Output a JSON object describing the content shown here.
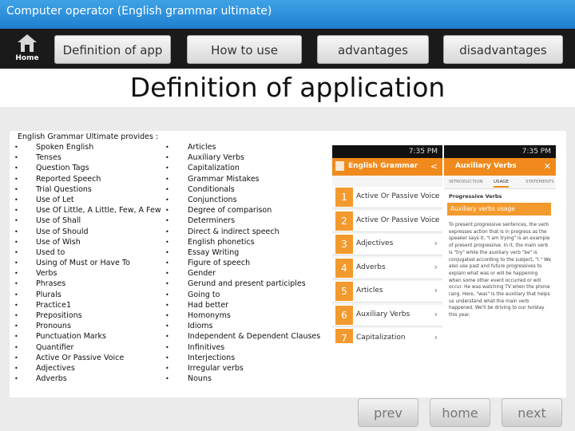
{
  "window": {
    "title": "Computer operator (English grammar ultimate)"
  },
  "nav": {
    "home_label": "Home",
    "tabs": [
      "Definition of app",
      "How to use",
      "advantages",
      "disadvantages"
    ]
  },
  "heading": "Definition of application",
  "list_intro": "English Grammar Ultimate provides :",
  "bullet": "•",
  "column1": [
    "Spoken English",
    "Tenses",
    "Question Tags",
    "Reported Speech",
    "Trial Questions",
    "Use of Let",
    "Use Of Little, A Little, Few, A Few",
    "Use of Shall",
    "Use of Should",
    "Use of Wish",
    "Used to",
    "Using of Must or Have To",
    "Verbs",
    "Phrases",
    "Plurals",
    "Practice1",
    "Prepositions",
    "Pronouns",
    "Punctuation Marks",
    "Quantifier",
    "Active Or Passive Voice",
    "Adjectives",
    "Adverbs"
  ],
  "column2": [
    "Articles",
    "Auxiliary Verbs",
    "Capitalization",
    "Grammar Mistakes",
    "Conditionals",
    "Conjunctions",
    "Degree of comparison",
    "Determiners",
    "Direct & indirect speech",
    "English phonetics",
    "Essay Writing",
    "Figure of speech",
    "Gender",
    "Gerund and present participles",
    "Going to",
    "Had better",
    "Homonyms",
    "Idioms",
    "Independent & Dependent Clauses",
    "Infinitives",
    "Interjections",
    "Irregular verbs",
    "Nouns"
  ],
  "phone": {
    "time_left": "7:35 PM",
    "time_right": "7:35 PM",
    "left_title": "English Grammar",
    "right_title": "Auxiliary Verbs",
    "items": [
      {
        "num": "1",
        "label": "Active Or Passive Voice"
      },
      {
        "num": "2",
        "label": "Active Or Passive Voice"
      },
      {
        "num": "3",
        "label": "Adjectives"
      },
      {
        "num": "4",
        "label": "Adverbs"
      },
      {
        "num": "5",
        "label": "Articles"
      },
      {
        "num": "6",
        "label": "Auxiliary Verbs"
      },
      {
        "num": "7",
        "label": "Capitalization"
      }
    ],
    "tabs": [
      "INTRODUCTION",
      "USAGE",
      "STATEMENTS"
    ],
    "section": "Progressive Verbs",
    "banner": "Auxiliary verbs usage",
    "body": "To present progressive sentences, the verb expresses action that is in progress as the speaker says it. \"I am trying\" is an example of present progressive. In it, the main verb is \"try\" while the auxiliary verb \"be\" is conjugated according to the subject, \"I.\" We also use past and future progressives to explain what was or will be happening when some other event occurred or will occur. He was watching TV when the phone rang. Here, \"was\" is the auxiliary that helps us understand what the main verb happened. We'll be driving to our holiday this year."
  },
  "buttons": {
    "prev": "prev",
    "home": "home",
    "next": "next"
  }
}
